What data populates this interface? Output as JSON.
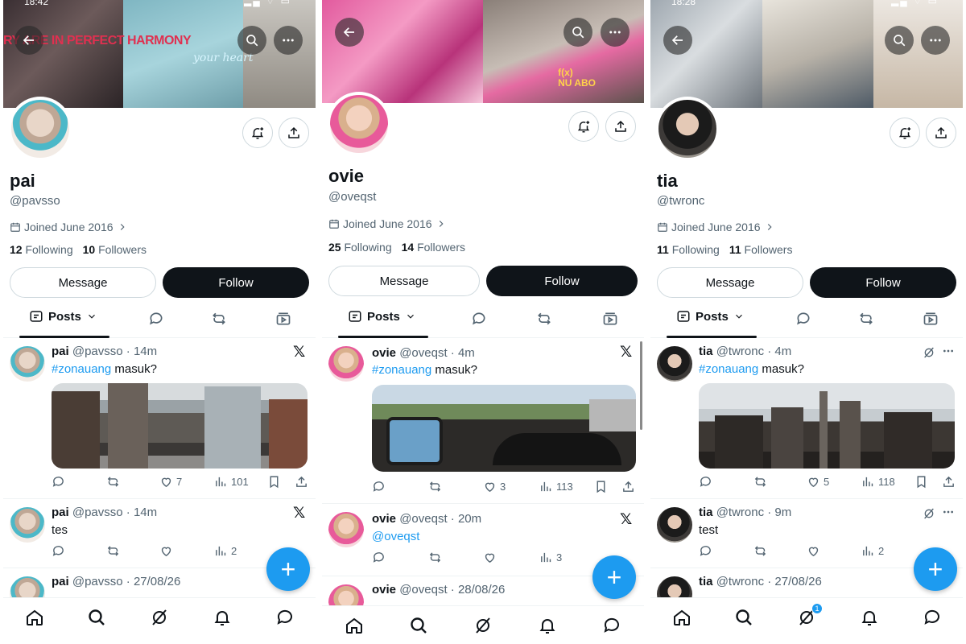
{
  "panels": [
    {
      "status_time": "18:42",
      "banner_text": "RY ARE IN PERFECT HARMONY",
      "banner_script": "your heart",
      "name": "pai",
      "handle": "@pavsso",
      "joined": "Joined June 2016",
      "following_count": "12",
      "following_label": "Following",
      "followers_count": "10",
      "followers_label": "Followers",
      "message_label": "Message",
      "follow_label": "Follow",
      "posts_tab": "Posts",
      "posts": [
        {
          "name": "pai",
          "handle_time": "@pavsso · 14m",
          "tag": "#zonauang",
          "text": " masuk?",
          "likes": "7",
          "views": "101"
        },
        {
          "name": "pai",
          "handle_time": "@pavsso · 14m",
          "text": "tes",
          "views": "2"
        },
        {
          "name": "pai",
          "handle_time": "@pavsso · 27/08/26"
        }
      ]
    },
    {
      "status_time": "",
      "banner_album_line1": "f(x)",
      "banner_album_line2": "NU ABO",
      "name": "ovie",
      "handle": "@oveqst",
      "joined": "Joined June 2016",
      "following_count": "25",
      "following_label": "Following",
      "followers_count": "14",
      "followers_label": "Followers",
      "message_label": "Message",
      "follow_label": "Follow",
      "posts_tab": "Posts",
      "posts": [
        {
          "name": "ovie",
          "handle_time": "@oveqst · 4m",
          "tag": "#zonauang",
          "text": " masuk?",
          "likes": "3",
          "views": "113"
        },
        {
          "name": "ovie",
          "handle_time": "@oveqst · 20m",
          "mention": "@oveqst",
          "views": "3"
        },
        {
          "name": "ovie",
          "handle_time": "@oveqst · 28/08/26"
        }
      ]
    },
    {
      "status_time": "18:28",
      "name": "tia",
      "handle": "@twronc",
      "joined": "Joined June 2016",
      "following_count": "11",
      "following_label": "Following",
      "followers_count": "11",
      "followers_label": "Followers",
      "message_label": "Message",
      "follow_label": "Follow",
      "posts_tab": "Posts",
      "notif_badge": "1",
      "posts": [
        {
          "name": "tia",
          "handle_time": "@twronc · 4m",
          "tag": "#zonauang",
          "text": " masuk?",
          "likes": "5",
          "views": "118"
        },
        {
          "name": "tia",
          "handle_time": "@twronc · 9m",
          "text": "test",
          "views": "2"
        },
        {
          "name": "tia",
          "handle_time": "@twronc · 27/08/26"
        }
      ]
    }
  ],
  "colors": {
    "accent": "#1d9bf0",
    "text": "#0f1419",
    "muted": "#536471",
    "follow_bg": "#0f1419"
  }
}
